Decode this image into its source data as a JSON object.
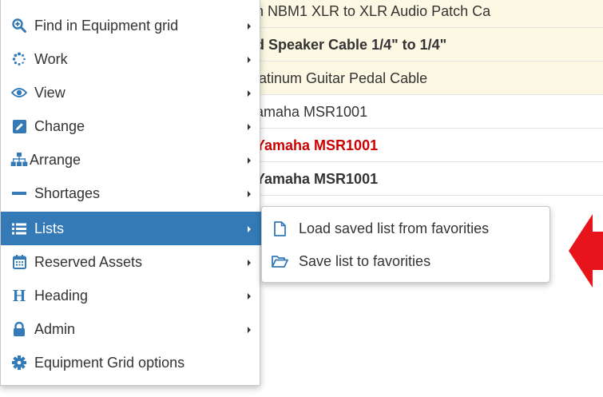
{
  "grid": {
    "rows": [
      "n NBM1 XLR to XLR Audio Patch Ca",
      "d Speaker Cable 1/4\" to 1/4\"",
      "latinum Guitar Pedal Cable",
      "amaha MSR1001",
      "Yamaha MSR1001",
      "Yamaha MSR1001"
    ]
  },
  "menu": {
    "items": [
      {
        "label": "Find in Equipment grid",
        "icon": "search-plus-icon"
      },
      {
        "label": "Work",
        "icon": "spinner-icon"
      },
      {
        "label": "View",
        "icon": "eye-icon"
      },
      {
        "label": "Change",
        "icon": "edit-icon"
      },
      {
        "label": "Arrange",
        "icon": "sitemap-icon"
      },
      {
        "label": "Shortages",
        "icon": "minus-icon"
      },
      {
        "label": "Lists",
        "icon": "list-icon"
      },
      {
        "label": "Reserved Assets",
        "icon": "calendar-icon"
      },
      {
        "label": "Heading",
        "icon": "header-icon"
      },
      {
        "label": "Admin",
        "icon": "lock-icon"
      },
      {
        "label": "Equipment Grid options",
        "icon": "gear-icon"
      }
    ]
  },
  "submenu": {
    "items": [
      {
        "label": "Load saved list from favorities",
        "icon": "file-icon"
      },
      {
        "label": "Save list to favorities",
        "icon": "folder-open-icon"
      }
    ]
  },
  "colors": {
    "accent": "#337ab7",
    "highlight_row": "#fcf8e3",
    "alert_text": "#cc0000",
    "annotation_arrow": "#e8141c"
  }
}
